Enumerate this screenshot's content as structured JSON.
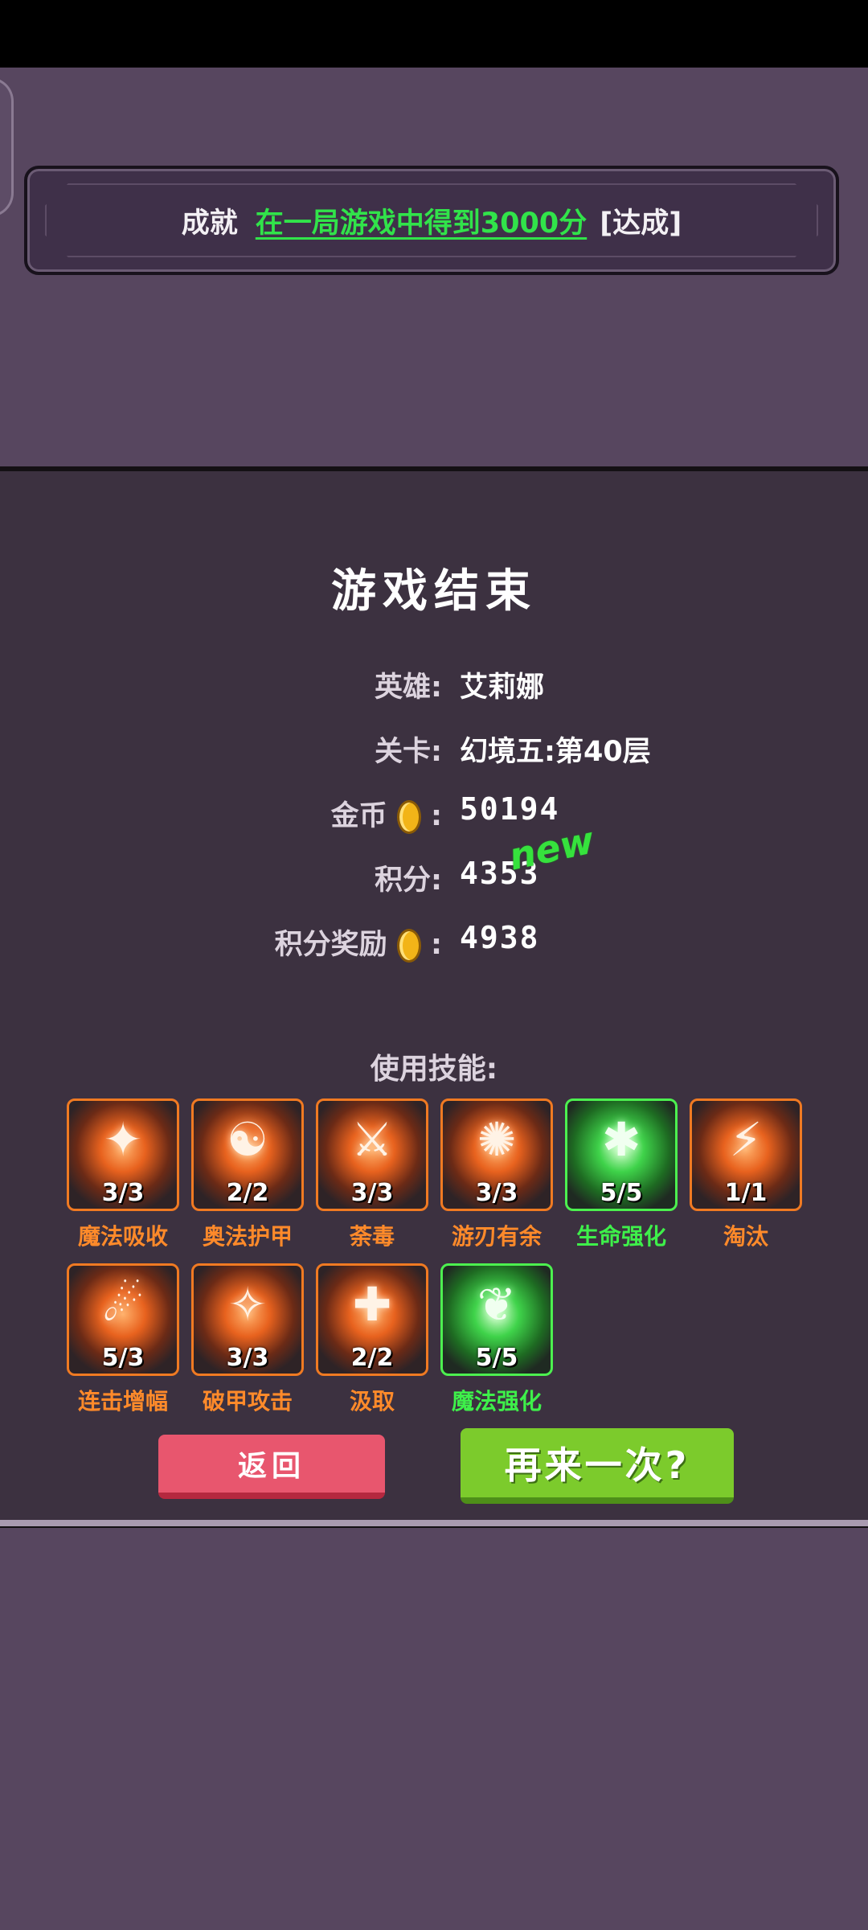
{
  "achievement": {
    "label": "成就",
    "task": "在一局游戏中得到3000分",
    "status": "[达成]"
  },
  "result": {
    "title": "游戏结束",
    "hero_label": "英雄:",
    "hero_value": "艾莉娜",
    "stage_label": "关卡:",
    "stage_value": "幻境五:第40层",
    "gold_label": "金币",
    "gold_colon": ":",
    "gold_value": "50194",
    "score_label": "积分:",
    "score_value": "4353",
    "score_new_tag": "new",
    "reward_label": "积分奖励",
    "reward_colon": ":",
    "reward_value": "4938"
  },
  "skills_title": "使用技能:",
  "skills": [
    {
      "name": "魔法吸收",
      "count": "3/3",
      "icon": "phoenix-icon",
      "color": "orange"
    },
    {
      "name": "奥法护甲",
      "count": "2/2",
      "icon": "meditation-shield-icon",
      "color": "orange"
    },
    {
      "name": "荼毒",
      "count": "3/3",
      "icon": "poison-blade-icon",
      "color": "orange"
    },
    {
      "name": "游刃有余",
      "count": "3/3",
      "icon": "spinning-blade-icon",
      "color": "orange"
    },
    {
      "name": "生命强化",
      "count": "5/5",
      "icon": "life-burst-icon",
      "color": "green"
    },
    {
      "name": "淘汰",
      "count": "1/1",
      "icon": "slash-icon",
      "color": "orange"
    },
    {
      "name": "连击增幅",
      "count": "5/3",
      "icon": "combo-kick-icon",
      "color": "orange"
    },
    {
      "name": "破甲攻击",
      "count": "3/3",
      "icon": "armor-break-icon",
      "color": "orange"
    },
    {
      "name": "汲取",
      "count": "2/2",
      "icon": "drain-cross-icon",
      "color": "orange"
    },
    {
      "name": "魔法强化",
      "count": "5/5",
      "icon": "spellbook-icon",
      "color": "green"
    }
  ],
  "buttons": {
    "back": "返回",
    "retry": "再来一次?"
  },
  "colors": {
    "background": "#57465f",
    "panel": "#3c3140",
    "accent_green": "#31e34a",
    "accent_orange": "#ff8a2a",
    "back_button": "#e8566e",
    "retry_button": "#7ccb2c"
  }
}
